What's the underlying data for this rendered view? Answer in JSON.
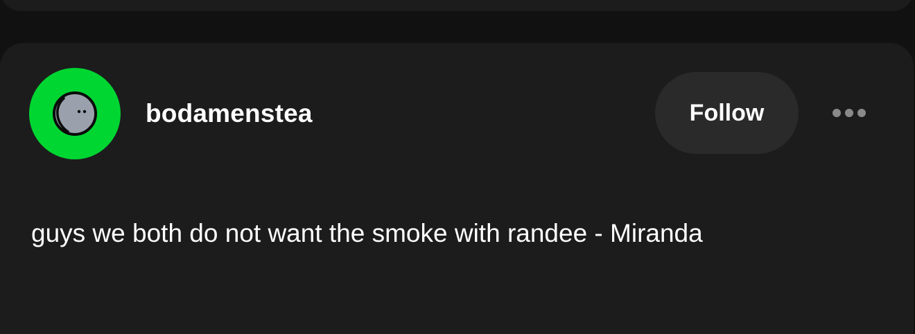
{
  "post": {
    "username": "bodamenstea",
    "follow_label": "Follow",
    "body": "guys we both do not want the smoke with randee - Miranda",
    "avatar_icon": "moon-face-icon",
    "more_icon": "more-options-icon"
  },
  "colors": {
    "page_background": "#111111",
    "card_background": "#1c1c1c",
    "avatar_background": "#00d632",
    "follow_button_background": "#2a2a2a",
    "text": "#ffffff",
    "more_dots": "#8a8a8a"
  }
}
